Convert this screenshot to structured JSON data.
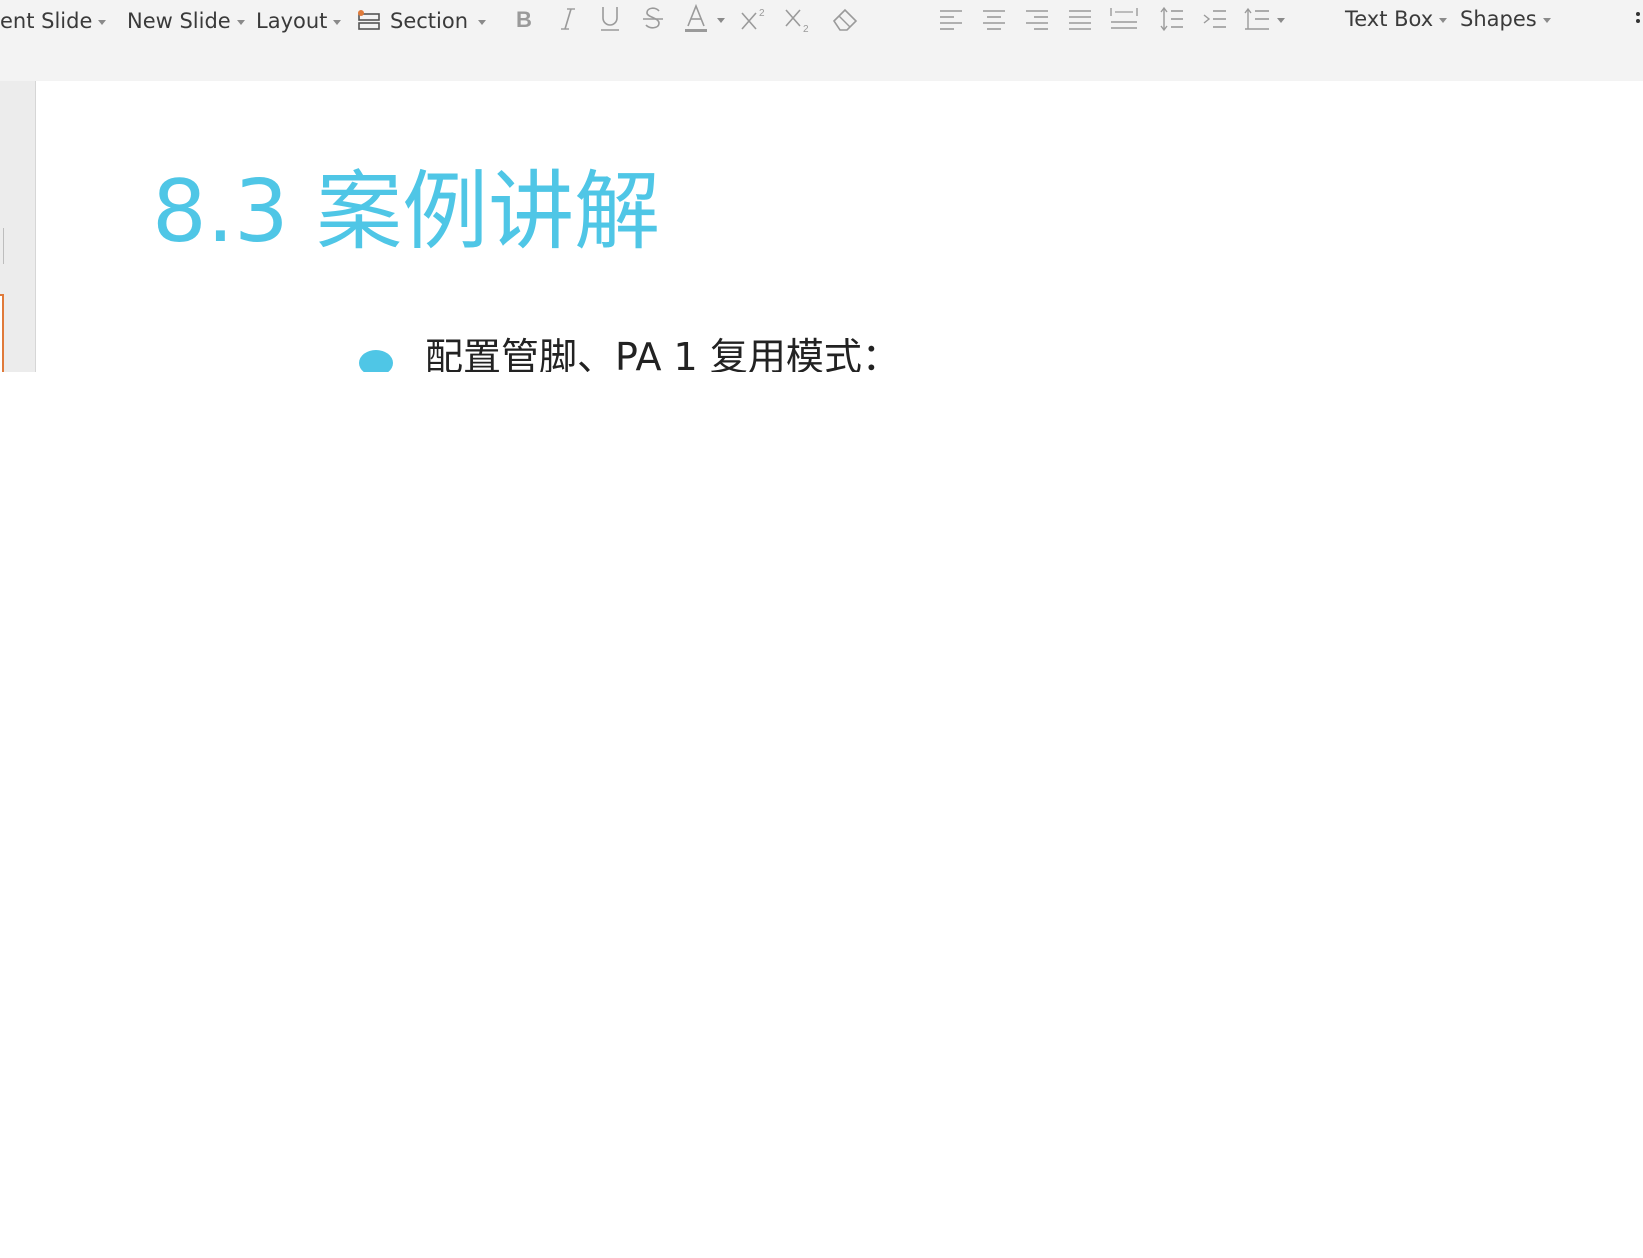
{
  "toolbar": {
    "items": [
      {
        "label": "ent Slide",
        "has_caret": true
      },
      {
        "label": "New Slide",
        "has_caret": true
      },
      {
        "label": "Layout",
        "has_caret": true
      },
      {
        "label": "Section",
        "has_caret": true,
        "icon": "section-icon"
      },
      {
        "label": "Text Box",
        "has_caret": true
      },
      {
        "label": "Shapes",
        "has_caret": true
      }
    ],
    "format_icons": [
      "bold-icon",
      "italic-icon",
      "underline-icon",
      "strikethrough-icon",
      "font-color-icon",
      "superscript-icon",
      "subscript-icon",
      "clear-format-icon"
    ],
    "paragraph_icons": [
      "align-left-icon",
      "align-center-icon",
      "align-right-icon",
      "justify-icon",
      "distributed-icon",
      "line-spacing-icon",
      "decrease-indent-icon",
      "paragraph-spacing-icon"
    ],
    "colors": {
      "background": "#f3f3f3",
      "icon": "#8f8f8f",
      "text": "#3a3a3a"
    }
  },
  "slide": {
    "title": "8.3 案例讲解",
    "bullet": "配置管脚、PA 1 复用模式：",
    "colors": {
      "accent": "#4fc6e6",
      "text": "#222222"
    }
  }
}
